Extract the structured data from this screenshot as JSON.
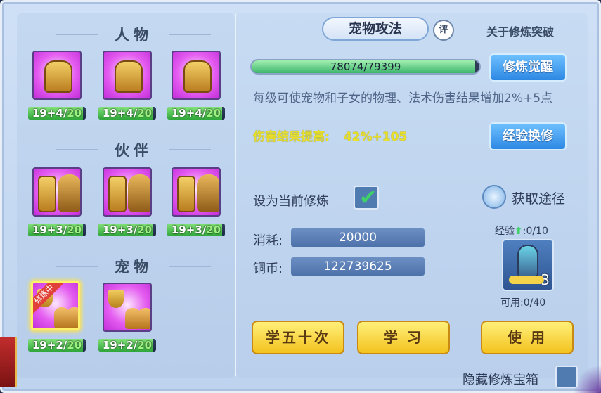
{
  "sections": {
    "people": "人物",
    "partner": "伙伴",
    "pet": "宠物"
  },
  "cards": [
    {
      "level": "19+4/",
      "max": "20",
      "fill": 0.95
    },
    {
      "level": "19+4/",
      "max": "20",
      "fill": 0.95
    },
    {
      "level": "19+4/",
      "max": "20",
      "fill": 0.95
    },
    {
      "level": "19+3/",
      "max": "20",
      "fill": 0.95
    },
    {
      "level": "19+3/",
      "max": "20",
      "fill": 0.95
    },
    {
      "level": "19+3/",
      "max": "20",
      "fill": 0.95
    },
    {
      "level": "19+2/",
      "max": "20",
      "fill": 0.95
    },
    {
      "level": "19+2/",
      "max": "20",
      "fill": 0.95
    }
  ],
  "training_ribbon": "修炼中",
  "right": {
    "tab_title": "宠物攻法",
    "rating_badge": "评",
    "breakthrough_link": "关于修炼突破",
    "progress_text": "78074/79399",
    "progress_fraction": 0.983,
    "awaken_button": "修炼觉醒",
    "description": "每级可使宠物和子女的物理、法术伤害结果增加2%+5点",
    "boost_label": "伤害结果提高:",
    "boost_value": "42%+105",
    "exchange_button": "经验换修",
    "set_current_label": "设为当前修炼",
    "get_path_label": "获取途径",
    "cost_label": "消耗:",
    "cost_value": "20000",
    "copper_label": "铜币:",
    "copper_value": "122739625",
    "exp_label": "经验",
    "exp_value": ":0/10",
    "item_count": "3",
    "available": "可用:0/40",
    "learn50_button": "学五十次",
    "learn_button": "学 习",
    "use_button": "使 用",
    "hide_box_label": "隐藏修炼宝箱"
  }
}
